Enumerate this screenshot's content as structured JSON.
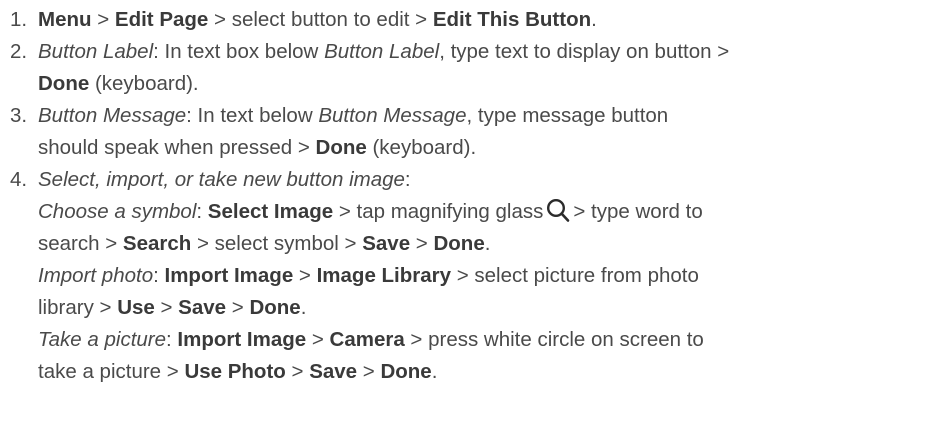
{
  "steps": [
    {
      "num": "1.",
      "parts": [
        {
          "t": "b",
          "v": "Menu"
        },
        {
          "t": "n",
          "v": " > "
        },
        {
          "t": "b",
          "v": "Edit Page"
        },
        {
          "t": "n",
          "v": " > select button to edit > "
        },
        {
          "t": "b",
          "v": "Edit This Button"
        },
        {
          "t": "n",
          "v": "."
        }
      ]
    },
    {
      "num": "2.",
      "lines": [
        [
          {
            "t": "i",
            "v": "Button Label"
          },
          {
            "t": "n",
            "v": ": In text box below "
          },
          {
            "t": "i",
            "v": "Button Label"
          },
          {
            "t": "n",
            "v": ", type text to display on button >"
          }
        ],
        [
          {
            "t": "b",
            "v": "Done"
          },
          {
            "t": "n",
            "v": " (keyboard)."
          }
        ]
      ]
    },
    {
      "num": "3.",
      "lines": [
        [
          {
            "t": "i",
            "v": "Button Message"
          },
          {
            "t": "n",
            "v": ": In text below "
          },
          {
            "t": "i",
            "v": "Button Message"
          },
          {
            "t": "n",
            "v": ", type message button"
          }
        ],
        [
          {
            "t": "n",
            "v": "should speak when pressed > "
          },
          {
            "t": "b",
            "v": "Done"
          },
          {
            "t": "n",
            "v": " (keyboard)."
          }
        ]
      ]
    },
    {
      "num": "4.",
      "lines": [
        [
          {
            "t": "i",
            "v": "Select, import, or take new button image"
          },
          {
            "t": "n",
            "v": ":"
          }
        ],
        [
          {
            "t": "i",
            "v": "Choose a symbol"
          },
          {
            "t": "n",
            "v": ": "
          },
          {
            "t": "b",
            "v": "Select Image"
          },
          {
            "t": "n",
            "v": " > tap magnifying glass"
          },
          {
            "t": "icon",
            "v": "magnifying-glass-icon"
          },
          {
            "t": "n",
            "v": "> type word to"
          }
        ],
        [
          {
            "t": "n",
            "v": "search > "
          },
          {
            "t": "b",
            "v": "Search"
          },
          {
            "t": "n",
            "v": " > select symbol > "
          },
          {
            "t": "b",
            "v": "Save"
          },
          {
            "t": "n",
            "v": " > "
          },
          {
            "t": "b",
            "v": "Done"
          },
          {
            "t": "n",
            "v": "."
          }
        ],
        [
          {
            "t": "i",
            "v": "Import photo"
          },
          {
            "t": "n",
            "v": ": "
          },
          {
            "t": "b",
            "v": "Import Image"
          },
          {
            "t": "n",
            "v": " > "
          },
          {
            "t": "b",
            "v": "Image Library"
          },
          {
            "t": "n",
            "v": " > select picture from photo"
          }
        ],
        [
          {
            "t": "n",
            "v": "library > "
          },
          {
            "t": "b",
            "v": "Use"
          },
          {
            "t": "n",
            "v": " > "
          },
          {
            "t": "b",
            "v": "Save"
          },
          {
            "t": "n",
            "v": " > "
          },
          {
            "t": "b",
            "v": "Done"
          },
          {
            "t": "n",
            "v": "."
          }
        ],
        [
          {
            "t": "i",
            "v": "Take a picture"
          },
          {
            "t": "n",
            "v": ": "
          },
          {
            "t": "b",
            "v": "Import Image"
          },
          {
            "t": "n",
            "v": " > "
          },
          {
            "t": "b",
            "v": "Camera"
          },
          {
            "t": "n",
            "v": " > press white circle on screen to"
          }
        ],
        [
          {
            "t": "n",
            "v": "take a picture > "
          },
          {
            "t": "b",
            "v": "Use Photo"
          },
          {
            "t": "n",
            "v": " > "
          },
          {
            "t": "b",
            "v": "Save"
          },
          {
            "t": "n",
            "v": " > "
          },
          {
            "t": "b",
            "v": "Done"
          },
          {
            "t": "n",
            "v": "."
          }
        ]
      ]
    }
  ],
  "colors": {
    "text": "#4a4a4a",
    "bold_text": "#3a3a3a",
    "icon": "#2b2b2b"
  }
}
